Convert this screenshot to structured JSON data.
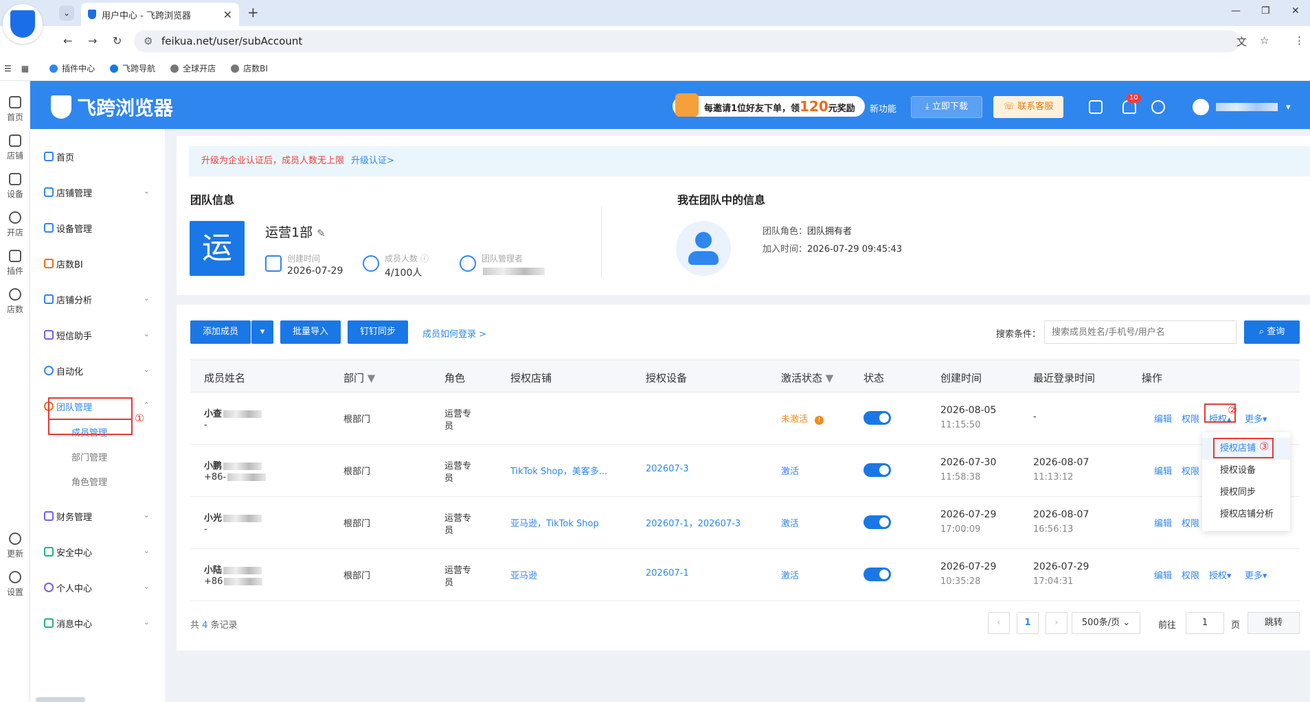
{
  "browser": {
    "tab_title": "用户中心 - 飞跨浏览器",
    "url": "feikua.net/user/subAccount",
    "bookmarks": [
      "插件中心",
      "飞跨导航",
      "全球开店",
      "店数BI"
    ]
  },
  "rail": [
    "首页",
    "店铺",
    "设备",
    "开店",
    "插件",
    "店数",
    "更新",
    "设置"
  ],
  "header": {
    "brand": "飞跨浏览器",
    "promo_pre": "每邀请1位好友下单，领",
    "promo_num": "120",
    "promo_post": "元奖励",
    "new_feature": "新功能",
    "download": "立即下载",
    "contact": "联系客服",
    "bell_badge": "10"
  },
  "sidebar": {
    "items": [
      "首页",
      "店铺管理",
      "设备管理",
      "店数BI",
      "店铺分析",
      "短信助手",
      "自动化",
      "团队管理",
      "财务管理",
      "安全中心",
      "个人中心",
      "消息中心"
    ],
    "sub": [
      "成员管理",
      "部门管理",
      "角色管理"
    ],
    "marker1": "①"
  },
  "notice": {
    "text": "升级为企业认证后，成员人数无上限",
    "link": "升级认证>"
  },
  "team": {
    "title": "团队信息",
    "avatar_char": "运",
    "name": "运营1部",
    "created_label": "创建时间",
    "created_value": "2026-07-29",
    "members_label": "成员人数",
    "members_value": "4/100人",
    "admin_label": "团队管理者"
  },
  "me": {
    "title": "我在团队中的信息",
    "role_label": "团队角色：",
    "role_value": "团队拥有者",
    "join_label": "加入时间：",
    "join_value": "2026-07-29 09:45:43"
  },
  "toolbar": {
    "add": "添加成员",
    "import": "批量导入",
    "sync": "钉钉同步",
    "howto": "成员如何登录 >",
    "search_label": "搜索条件：",
    "search_placeholder": "搜索成员姓名/手机号/用户名",
    "query": "查询"
  },
  "table": {
    "headers": [
      "成员姓名",
      "部门",
      "角色",
      "授权店铺",
      "授权设备",
      "激活状态",
      "状态",
      "创建时间",
      "最近登录时间",
      "操作"
    ],
    "rows": [
      {
        "name": "小查",
        "sub": "-",
        "dept": "根部门",
        "role1": "运营专",
        "role2": "员",
        "shops": "",
        "devices": "",
        "status": "未激活",
        "c_date": "2026-08-05",
        "c_time": "11:15:50",
        "l_date": "-",
        "l_time": ""
      },
      {
        "name": "小鹏",
        "sub": "+86-",
        "dept": "根部门",
        "role1": "运营专",
        "role2": "员",
        "shops": "TikTok Shop，美客多...",
        "devices": "202607-3",
        "status": "激活",
        "c_date": "2026-07-30",
        "c_time": "11:58:38",
        "l_date": "2026-08-07",
        "l_time": "11:13:12"
      },
      {
        "name": "小光",
        "sub": "-",
        "dept": "根部门",
        "role1": "运营专",
        "role2": "员",
        "shops": "亚马逊，TikTok Shop",
        "devices": "202607-1，202607-3",
        "status": "激活",
        "c_date": "2026-07-29",
        "c_time": "17:00:09",
        "l_date": "2026-08-07",
        "l_time": "16:56:13"
      },
      {
        "name": "小陆",
        "sub": "+86",
        "dept": "根部门",
        "role1": "运营专",
        "role2": "员",
        "shops": "亚马逊",
        "devices": "202607-1",
        "status": "激活",
        "c_date": "2026-07-29",
        "c_time": "10:35:28",
        "l_date": "2026-07-29",
        "l_time": "17:04:31"
      }
    ],
    "ops": {
      "edit": "编辑",
      "perm": "权限",
      "auth": "授权",
      "more": "更多"
    },
    "marker2": "②"
  },
  "dropdown": {
    "items": [
      "授权店铺",
      "授权设备",
      "授权同步",
      "授权店铺分析"
    ],
    "marker3": "③"
  },
  "footer": {
    "total_pre": "共",
    "total_num": "4",
    "total_post": "条记录",
    "page": "1",
    "page_size": "500条/页",
    "goto_label": "前往",
    "goto_value": "1",
    "page_unit": "页",
    "jump": "跳转"
  }
}
